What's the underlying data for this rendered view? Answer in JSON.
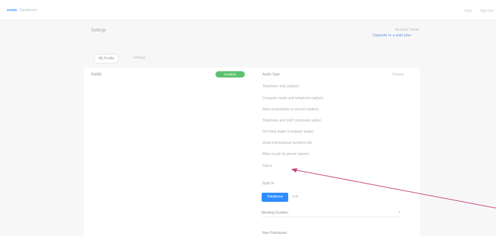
{
  "header": {
    "logo": "zoom",
    "subtitle": "Dashboard",
    "right_1": "Help",
    "right_2": "Sign Out"
  },
  "page": {
    "title": "Settings",
    "status_label": "Account Owner",
    "status_link": "Upgrade to a paid plan"
  },
  "tabs": [
    "My Profile",
    "Settings"
  ],
  "row": {
    "label": "Audio",
    "badge": "Enabled"
  },
  "section": {
    "title": "Audio Type",
    "action": "Choose",
    "items": [
      "Telephone only (option)",
      "Computer audio and telephone (option)",
      "Allow participants to choose (option)",
      "Telephone and VoIP (computer audio)",
      "3rd Party Audio (computer audio)",
      "Show international numbers link",
      "Allow to join by phone (option)",
      "Dial-in"
    ]
  },
  "audio": {
    "label": "Sync In",
    "primary_button": "Telephone",
    "secondary_button": "Edit",
    "select_value": "Meeting Duration"
  },
  "bottom_title": "New Participant"
}
